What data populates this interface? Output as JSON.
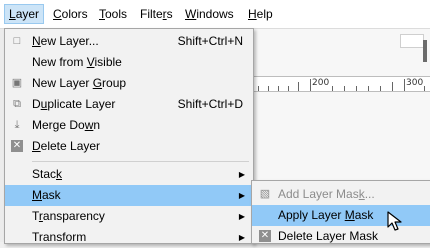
{
  "menubar": {
    "items": [
      {
        "label": "Layer",
        "mnemonic": "L",
        "rest": "ayer",
        "active": true
      },
      {
        "label": "Colors",
        "mnemonic": "C",
        "rest": "olors"
      },
      {
        "label": "Tools",
        "mnemonic": "T",
        "rest": "ools"
      },
      {
        "label": "Filters",
        "mnemonic": "r",
        "pre": "Filte",
        "rest": "s"
      },
      {
        "label": "Windows",
        "mnemonic": "W",
        "rest": "indows"
      },
      {
        "label": "Help",
        "mnemonic": "H",
        "rest": "elp"
      }
    ]
  },
  "ruler": {
    "labels": [
      "200",
      "300"
    ]
  },
  "layer_menu": {
    "items": [
      {
        "pre": "",
        "m": "N",
        "post": "ew Layer...",
        "shortcut": "Shift+Ctrl+N",
        "icon": "new-layer-icon"
      },
      {
        "pre": "New from ",
        "m": "V",
        "post": "isible",
        "shortcut": ""
      },
      {
        "pre": "New Layer ",
        "m": "G",
        "post": "roup",
        "shortcut": "",
        "icon": "layer-group-icon"
      },
      {
        "pre": "D",
        "m": "u",
        "post": "plicate Layer",
        "shortcut": "Shift+Ctrl+D",
        "icon": "duplicate-icon"
      },
      {
        "pre": "Merge Do",
        "m": "w",
        "post": "n",
        "shortcut": "",
        "icon": "merge-down-icon"
      },
      {
        "pre": "",
        "m": "D",
        "post": "elete Layer",
        "shortcut": "",
        "icon": "delete-layer-icon"
      },
      {
        "pre": "Stac",
        "m": "k",
        "post": "",
        "submenu": true
      },
      {
        "pre": "",
        "m": "M",
        "post": "ask",
        "submenu": true,
        "highlighted": true
      },
      {
        "pre": "T",
        "m": "r",
        "post": "ansparency",
        "submenu": true
      },
      {
        "pre": "Transform",
        "m": "",
        "post": "",
        "submenu": true
      }
    ]
  },
  "mask_submenu": {
    "items": [
      {
        "pre": "Add Layer Mas",
        "m": "k",
        "post": "...",
        "disabled": true,
        "icon": "add-mask-icon"
      },
      {
        "pre": "Apply Layer ",
        "m": "M",
        "post": "ask",
        "highlighted": true
      },
      {
        "pre": "Delete Layer Mask",
        "m": "",
        "post": "",
        "icon": "delete-mask-icon"
      }
    ]
  },
  "colors": {
    "highlight": "#91c9f7",
    "menubar_active": "#cce4f7"
  }
}
